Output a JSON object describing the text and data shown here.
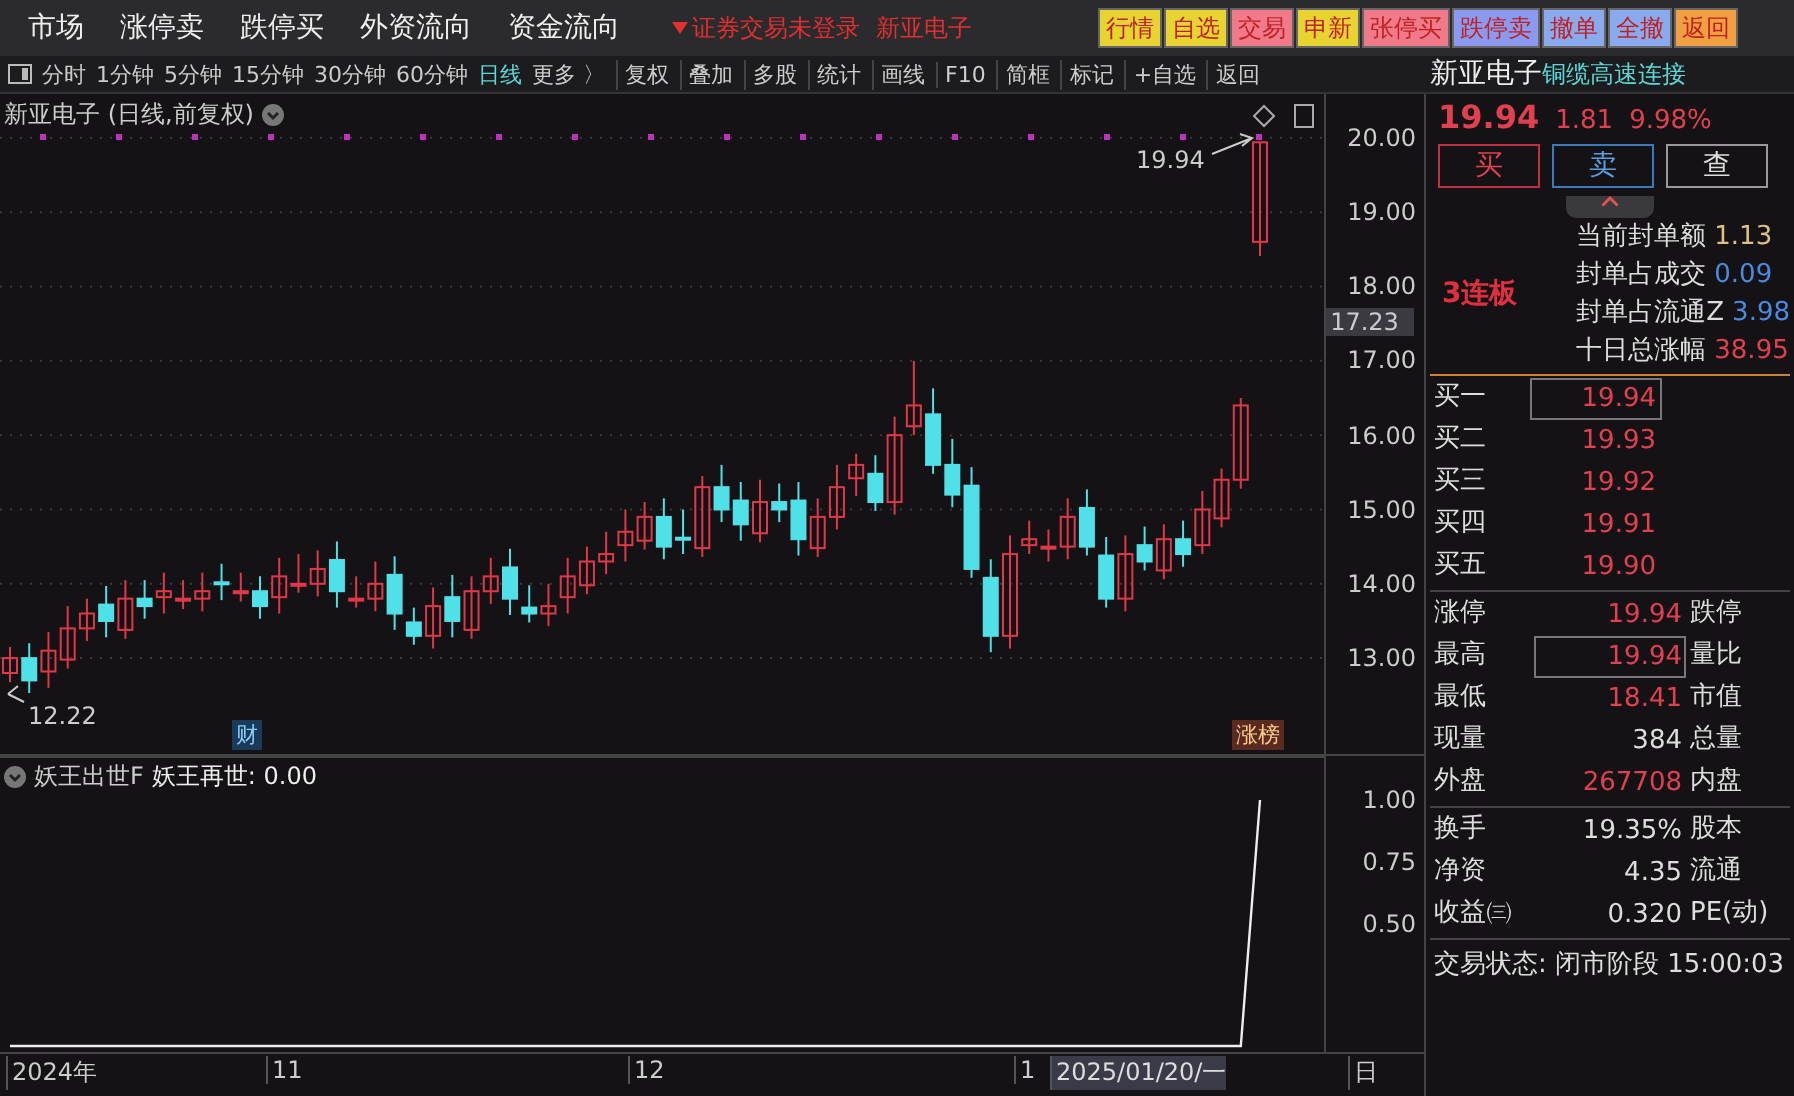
{
  "menu": [
    "市场",
    "涨停卖",
    "跌停买",
    "外资流向",
    "资金流向"
  ],
  "login_status": "证券交易未登录",
  "stock_name_top": "新亚电子",
  "quick_buttons": [
    {
      "label": "行情",
      "color": "#e8d430"
    },
    {
      "label": "自选",
      "color": "#e8d430"
    },
    {
      "label": "交易",
      "color": "#f07a8a"
    },
    {
      "label": "申新",
      "color": "#e8d430"
    },
    {
      "label": "张停买",
      "color": "#f07a8a"
    },
    {
      "label": "跌停卖",
      "color": "#8a9af0"
    },
    {
      "label": "撤单",
      "color": "#8aaaf0"
    },
    {
      "label": "全撤",
      "color": "#8aaaf0"
    },
    {
      "label": "返回",
      "color": "#f0a040"
    }
  ],
  "periods": [
    {
      "label": "分时",
      "selected": false
    },
    {
      "label": "1分钟",
      "selected": false
    },
    {
      "label": "5分钟",
      "selected": false
    },
    {
      "label": "15分钟",
      "selected": false
    },
    {
      "label": "30分钟",
      "selected": false
    },
    {
      "label": "60分钟",
      "selected": false
    },
    {
      "label": "日线",
      "selected": true
    },
    {
      "label": "更多 〉",
      "selected": false
    }
  ],
  "tools": [
    "复权",
    "叠加",
    "多股",
    "统计",
    "画线",
    "F10",
    "简框",
    "标记",
    "+自选",
    "返回"
  ],
  "chart": {
    "title": "新亚电子 (日线,前复权)",
    "high_label": "19.94",
    "low_label": "12.22",
    "current_price": "17.23",
    "markers": [
      {
        "label": "财",
        "kind": "finance"
      },
      {
        "label": "涨榜",
        "kind": "rank"
      }
    ],
    "chart_data": {
      "type": "candlestick",
      "yticks": [
        {
          "value": 20,
          "label": "20.00"
        },
        {
          "value": 19,
          "label": "19.00"
        },
        {
          "value": 18,
          "label": "18.00"
        },
        {
          "value": 17,
          "label": "17.00"
        },
        {
          "value": 16,
          "label": "16.00"
        },
        {
          "value": 15,
          "label": "15.00"
        },
        {
          "value": 14,
          "label": "14.00"
        },
        {
          "value": 13,
          "label": "13.00"
        }
      ],
      "grid": true,
      "ylim": [
        11.71,
        20.59
      ],
      "ohlc": [
        [
          12.8,
          13.15,
          12.68,
          13.0
        ],
        [
          13.0,
          13.2,
          12.53,
          12.7
        ],
        [
          12.82,
          13.35,
          12.6,
          13.1
        ],
        [
          12.98,
          13.7,
          12.86,
          13.4
        ],
        [
          13.4,
          13.8,
          13.23,
          13.6
        ],
        [
          13.72,
          13.97,
          13.28,
          13.5
        ],
        [
          13.38,
          14.05,
          13.26,
          13.8
        ],
        [
          13.8,
          14.05,
          13.53,
          13.7
        ],
        [
          13.82,
          14.15,
          13.6,
          13.9
        ],
        [
          13.78,
          14.05,
          13.66,
          13.8
        ],
        [
          13.8,
          14.15,
          13.63,
          13.9
        ],
        [
          14.02,
          14.27,
          13.78,
          14.0
        ],
        [
          13.88,
          14.15,
          13.76,
          13.9
        ],
        [
          13.9,
          14.1,
          13.53,
          13.7
        ],
        [
          13.82,
          14.35,
          13.6,
          14.1
        ],
        [
          13.98,
          14.4,
          13.88,
          14.0
        ],
        [
          14.0,
          14.45,
          13.83,
          14.2
        ],
        [
          14.32,
          14.57,
          13.68,
          13.9
        ],
        [
          13.78,
          14.1,
          13.68,
          13.8
        ],
        [
          13.8,
          14.3,
          13.63,
          14.0
        ],
        [
          14.12,
          14.37,
          13.38,
          13.6
        ],
        [
          13.48,
          13.68,
          13.18,
          13.3
        ],
        [
          13.3,
          13.95,
          13.13,
          13.7
        ],
        [
          13.82,
          14.12,
          13.28,
          13.5
        ],
        [
          13.38,
          14.1,
          13.26,
          13.9
        ],
        [
          13.9,
          14.35,
          13.73,
          14.1
        ],
        [
          14.22,
          14.47,
          13.58,
          13.8
        ],
        [
          13.68,
          13.98,
          13.48,
          13.6
        ],
        [
          13.6,
          14.0,
          13.43,
          13.7
        ],
        [
          13.82,
          14.35,
          13.6,
          14.1
        ],
        [
          13.98,
          14.5,
          13.86,
          14.3
        ],
        [
          14.3,
          14.7,
          14.13,
          14.4
        ],
        [
          14.52,
          15.0,
          14.3,
          14.7
        ],
        [
          14.58,
          15.1,
          14.46,
          14.9
        ],
        [
          14.9,
          15.15,
          14.33,
          14.5
        ],
        [
          14.62,
          15.0,
          14.4,
          14.6
        ],
        [
          14.48,
          15.45,
          14.36,
          15.3
        ],
        [
          15.3,
          15.6,
          14.83,
          15.0
        ],
        [
          15.12,
          15.37,
          14.58,
          14.8
        ],
        [
          14.68,
          15.4,
          14.56,
          15.1
        ],
        [
          15.1,
          15.35,
          14.83,
          15.0
        ],
        [
          15.12,
          15.37,
          14.38,
          14.6
        ],
        [
          14.48,
          15.15,
          14.36,
          14.9
        ],
        [
          14.9,
          15.6,
          14.73,
          15.3
        ],
        [
          15.42,
          15.75,
          15.18,
          15.6
        ],
        [
          15.48,
          15.73,
          14.98,
          15.1
        ],
        [
          15.1,
          16.25,
          14.93,
          16.0
        ],
        [
          16.12,
          17.0,
          16.0,
          16.4
        ],
        [
          16.28,
          16.63,
          15.48,
          15.6
        ],
        [
          15.6,
          15.95,
          15.03,
          15.2
        ],
        [
          15.32,
          15.57,
          14.08,
          14.2
        ],
        [
          14.08,
          14.33,
          13.08,
          13.3
        ],
        [
          13.3,
          14.65,
          13.13,
          14.4
        ],
        [
          14.52,
          14.85,
          14.4,
          14.6
        ],
        [
          14.48,
          14.73,
          14.3,
          14.5
        ],
        [
          14.5,
          15.15,
          14.33,
          14.9
        ],
        [
          15.02,
          15.27,
          14.38,
          14.5
        ],
        [
          14.38,
          14.63,
          13.68,
          13.8
        ],
        [
          13.8,
          14.65,
          13.63,
          14.4
        ],
        [
          14.52,
          14.77,
          14.18,
          14.3
        ],
        [
          14.18,
          14.8,
          14.06,
          14.6
        ],
        [
          14.6,
          14.85,
          14.23,
          14.4
        ],
        [
          14.52,
          15.25,
          14.4,
          15.0
        ],
        [
          14.88,
          15.55,
          14.76,
          15.4
        ],
        [
          15.4,
          16.5,
          15.28,
          16.4
        ],
        [
          18.6,
          19.94,
          18.41,
          19.94
        ]
      ]
    }
  },
  "indicator": {
    "name": "妖王出世F",
    "value": "妖王再世: 0.00",
    "chart_data": {
      "type": "line",
      "ylim": [
        -0.024,
        1.179
      ],
      "yticks": [
        {
          "value": 1,
          "label": "1.00"
        },
        {
          "value": 0.75,
          "label": "0.75"
        },
        {
          "value": 0.5,
          "label": "0.50"
        }
      ],
      "series": [
        {
          "color": "#eeeeee",
          "values": [
            0,
            0,
            0,
            0,
            0,
            0,
            0,
            0,
            0,
            0,
            0,
            0,
            0,
            0,
            0,
            0,
            0,
            0,
            0,
            0,
            0,
            0,
            0,
            0,
            0,
            0,
            0,
            0,
            0,
            0,
            0,
            0,
            0,
            0,
            0,
            0,
            0,
            0,
            0,
            0,
            0,
            0,
            0,
            0,
            0,
            0,
            0,
            0,
            0,
            0,
            0,
            0,
            0,
            0,
            0,
            0,
            0,
            0,
            0,
            0,
            0,
            0,
            0,
            0,
            0,
            1
          ]
        }
      ]
    }
  },
  "x_axis": [
    {
      "label": "2024年",
      "selected": false
    },
    {
      "label": "11",
      "selected": false
    },
    {
      "label": "12",
      "selected": false
    },
    {
      "label": "1",
      "selected": false
    },
    {
      "label": "2025/01/20/一",
      "selected": true
    },
    {
      "label": "日",
      "selected": false
    }
  ],
  "quote": {
    "name": "新亚电子",
    "concept": "铜缆高速连接",
    "price": "19.94",
    "change": "1.81",
    "change_pct": "9.98%",
    "buttons": [
      {
        "label": "买",
        "kind": "buy"
      },
      {
        "label": "卖",
        "kind": "sell"
      },
      {
        "label": "查",
        "kind": "query"
      }
    ],
    "streak": "3连板",
    "seal": [
      {
        "label": "当前封单额",
        "value": "1.13",
        "color": "#e0c080"
      },
      {
        "label": "封单占成交",
        "value": "0.09",
        "color": "#4a8ae0"
      },
      {
        "label": "封单占流通Z",
        "value": "3.98",
        "color": "#4a8ae0"
      },
      {
        "label": "十日总涨幅",
        "value": "38.95",
        "color": "#e04050"
      }
    ],
    "bids": [
      {
        "label": "买一",
        "price": "19.94",
        "highlighted": true
      },
      {
        "label": "买二",
        "price": "19.93",
        "highlighted": false
      },
      {
        "label": "买三",
        "price": "19.92",
        "highlighted": false
      },
      {
        "label": "买四",
        "price": "19.91",
        "highlighted": false
      },
      {
        "label": "买五",
        "price": "19.90",
        "highlighted": false
      }
    ],
    "stats": [
      {
        "label": "涨停",
        "value": "19.94",
        "label2": "跌停",
        "color": "#e04050",
        "highlighted": false
      },
      {
        "label": "最高",
        "value": "19.94",
        "label2": "量比",
        "color": "#e04050",
        "highlighted": true
      },
      {
        "label": "最低",
        "value": "18.41",
        "label2": "市值",
        "color": "#e04050",
        "highlighted": false
      },
      {
        "label": "现量",
        "value": "384",
        "label2": "总量",
        "color": "#dddddd",
        "highlighted": false
      },
      {
        "label": "外盘",
        "value": "267708",
        "label2": "内盘",
        "color": "#e04050",
        "highlighted": false
      }
    ],
    "fundamentals": [
      {
        "label": "换手",
        "value": "19.35%",
        "label2": "股本"
      },
      {
        "label": "净资",
        "value": "4.35",
        "label2": "流通"
      },
      {
        "label": "收益㈢",
        "value": "0.320",
        "label2": "PE(动)"
      }
    ],
    "status": "交易状态: 闭市阶段 15:00:03"
  }
}
